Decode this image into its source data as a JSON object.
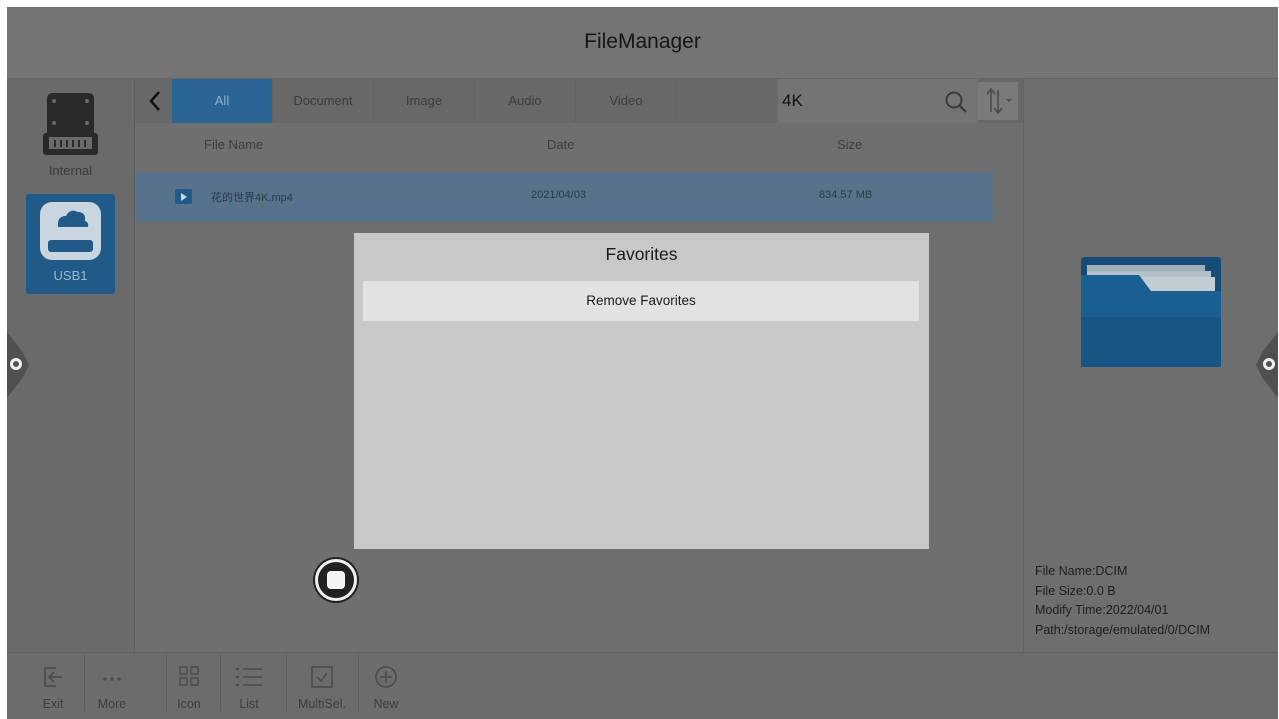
{
  "app": {
    "title": "FileManager"
  },
  "devices": [
    {
      "label": "Internal",
      "icon": "hard-drive-icon"
    },
    {
      "label": "USB1",
      "icon": "usb-drive-icon",
      "selected": true
    }
  ],
  "tabs": [
    {
      "label": "All",
      "active": true
    },
    {
      "label": "Document"
    },
    {
      "label": "Image"
    },
    {
      "label": "Audio"
    },
    {
      "label": "Video"
    }
  ],
  "search": {
    "value": "4K"
  },
  "columns": {
    "name": "File Name",
    "date": "Date",
    "size": "Size"
  },
  "files": [
    {
      "name": "花的世界4K.mp4",
      "date": "2021/04/03",
      "size": "834.57 MB",
      "icon": "video-file-icon"
    }
  ],
  "preview": {
    "icon": "folder-icon",
    "file_name": "File Name:DCIM",
    "file_size": "File Size:0.0 B",
    "modify_time": "Modify Time:2022/04/01",
    "path": "Path:/storage/emulated/0/DCIM"
  },
  "modal": {
    "title": "Favorites",
    "remove_label": "Remove Favorites"
  },
  "toolbar": {
    "exit": "Exit",
    "more": "More",
    "icon": "Icon",
    "list": "List",
    "multisel": "MultiSel.",
    "new": "New"
  },
  "colors": {
    "accent": "#2a6596",
    "selected_row": "#57728a",
    "modal_bg": "#c8c8c8"
  }
}
